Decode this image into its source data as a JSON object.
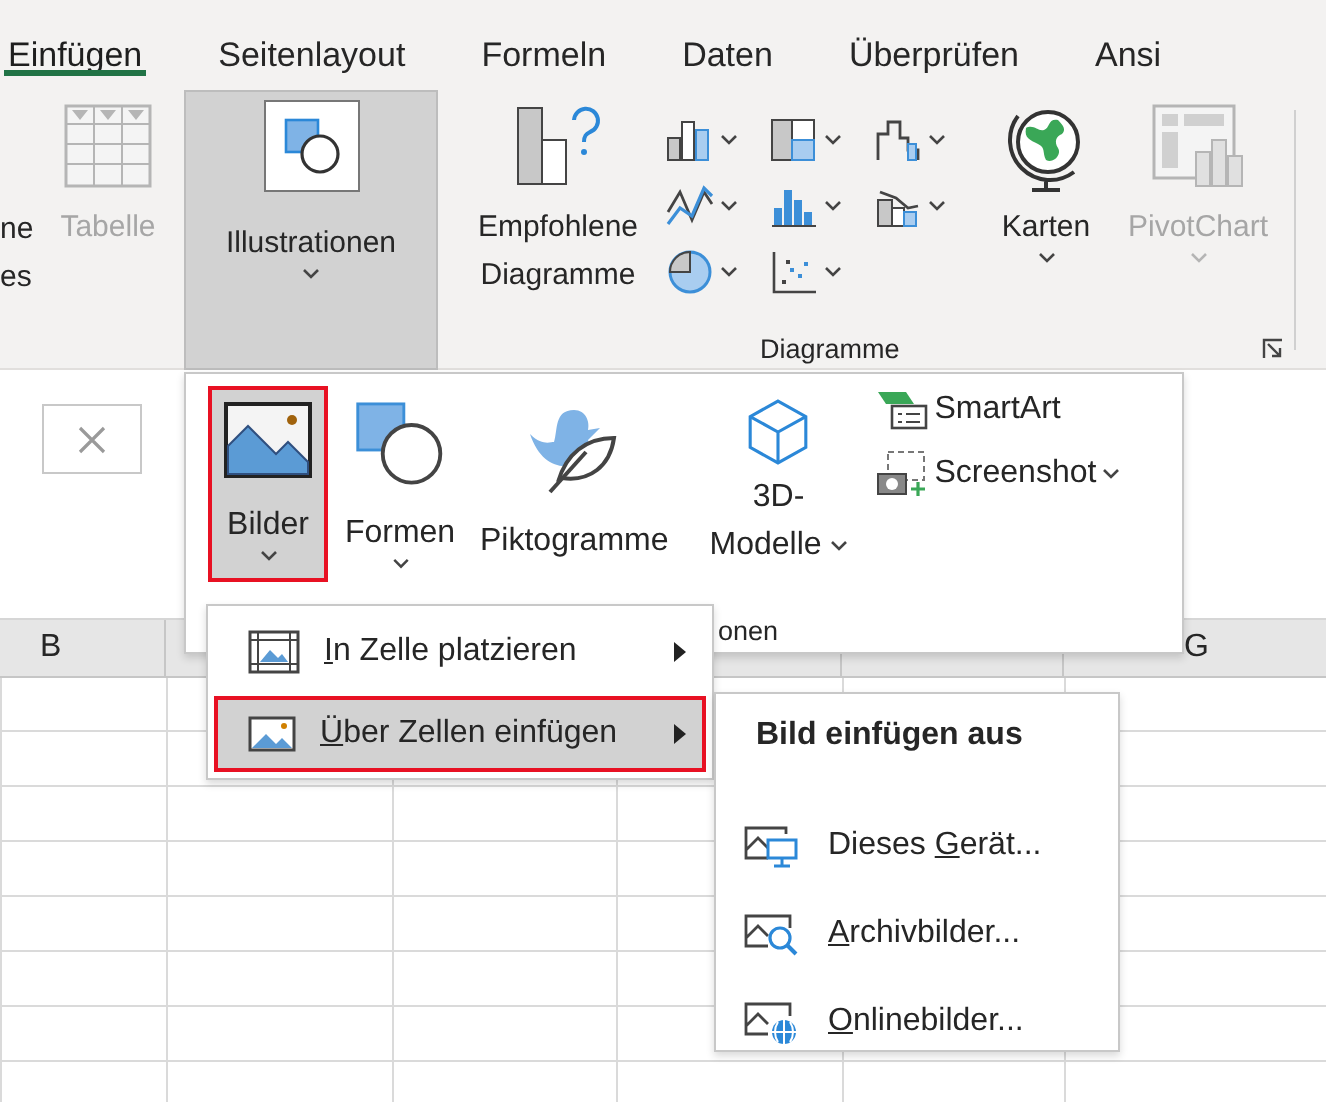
{
  "tabs": [
    {
      "label": "Einfügen",
      "selected": true
    },
    {
      "label": "Seitenlayout",
      "selected": false
    },
    {
      "label": "Formeln",
      "selected": false
    },
    {
      "label": "Daten",
      "selected": false
    },
    {
      "label": "Überprüfen",
      "selected": false
    },
    {
      "label": "Ansi",
      "selected": false
    }
  ],
  "ribbon": {
    "cut_label_lines": [
      "ne",
      "es"
    ],
    "table": {
      "label": "Tabelle",
      "disabled": true
    },
    "illustrations": {
      "label": "Illustrationen",
      "expanded": true
    },
    "recommended_charts": {
      "label": "Empfohlene Diagramme"
    },
    "chart_buttons": [
      {
        "kind": "column"
      },
      {
        "kind": "hierarchy"
      },
      {
        "kind": "waterfall"
      },
      {
        "kind": "line"
      },
      {
        "kind": "statistic"
      },
      {
        "kind": "combo"
      },
      {
        "kind": "pie"
      },
      {
        "kind": "scatter"
      }
    ],
    "maps": {
      "label": "Karten"
    },
    "pivot_chart": {
      "label": "PivotChart",
      "disabled": true
    },
    "group_label": "Diagramme"
  },
  "sheet": {
    "column_headers": [
      "B",
      "G"
    ]
  },
  "illustrations_gallery": {
    "large_items": [
      {
        "kind": "pictures",
        "label": "Bilder",
        "selected": true
      },
      {
        "kind": "shapes",
        "label": "Formen",
        "selected": false
      },
      {
        "kind": "icons",
        "label": "Piktogramme",
        "selected": false
      },
      {
        "kind": "models",
        "label": "3D-Modelle",
        "selected": false
      }
    ],
    "small_items": [
      {
        "kind": "smartart",
        "label": "SmartArt"
      },
      {
        "kind": "screenshot",
        "label": "Screenshot"
      }
    ],
    "group_label": "onen"
  },
  "pictures_menu": [
    {
      "key": "I",
      "after": "n Zelle platzieren",
      "selected": false,
      "kind": "in_cell"
    },
    {
      "key": "Ü",
      "after": "ber Zellen einfügen",
      "selected": true,
      "kind": "over_cells"
    }
  ],
  "insert_from_menu": {
    "header": "Bild einfügen aus",
    "items": [
      {
        "kind": "device",
        "before": "Dieses ",
        "key": "G",
        "after": "erät..."
      },
      {
        "kind": "stock",
        "key": "A",
        "after": "rchivbilder..."
      },
      {
        "kind": "online",
        "key": "O",
        "after": "nlinebilder..."
      }
    ]
  }
}
